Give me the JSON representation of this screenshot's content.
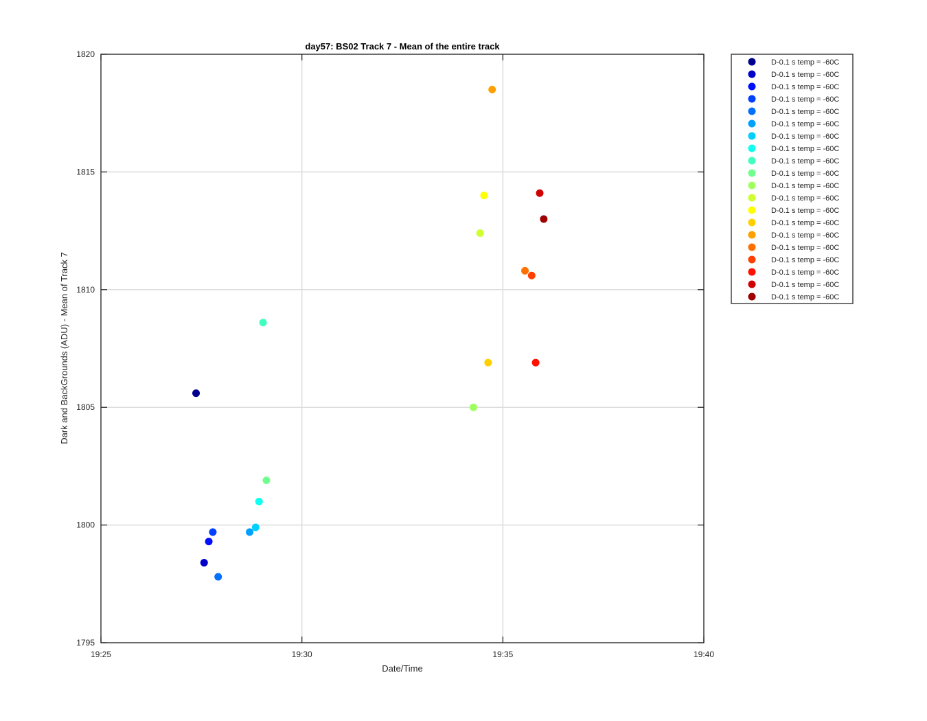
{
  "chart_data": {
    "type": "scatter",
    "title": "day57: BS02  Track 7 - Mean of the entire track",
    "xlabel": "Date/Time",
    "ylabel": "Dark and BackGrounds (ADU) - Mean of Track 7",
    "xlim": [
      "19:25",
      "19:40"
    ],
    "ylim": [
      1795,
      1820
    ],
    "xticks": [
      "19:25",
      "19:30",
      "19:35",
      "19:40"
    ],
    "yticks": [
      1795,
      1800,
      1805,
      1810,
      1815,
      1820
    ],
    "grid": true,
    "legend_position": "outside-right",
    "series": [
      {
        "name": "D-0.1 s temp = -60C",
        "color": "#00008f",
        "points": [
          {
            "x": "19:27:22",
            "y": 1805.6
          }
        ]
      },
      {
        "name": "D-0.1 s temp = -60C",
        "color": "#0000c8",
        "points": [
          {
            "x": "19:27:34",
            "y": 1798.4
          }
        ]
      },
      {
        "name": "D-0.1 s temp = -60C",
        "color": "#0010ff",
        "points": [
          {
            "x": "19:27:41",
            "y": 1799.3
          }
        ]
      },
      {
        "name": "D-0.1 s temp = -60C",
        "color": "#0040ff",
        "points": [
          {
            "x": "19:27:47",
            "y": 1799.7
          }
        ]
      },
      {
        "name": "D-0.1 s temp = -60C",
        "color": "#0070ff",
        "points": [
          {
            "x": "19:27:55",
            "y": 1797.8
          }
        ]
      },
      {
        "name": "D-0.1 s temp = -60C",
        "color": "#00a0ff",
        "points": [
          {
            "x": "19:28:42",
            "y": 1799.7
          }
        ]
      },
      {
        "name": "D-0.1 s temp = -60C",
        "color": "#00cfff",
        "points": [
          {
            "x": "19:28:51",
            "y": 1799.9
          }
        ]
      },
      {
        "name": "D-0.1 s temp = -60C",
        "color": "#10ffef",
        "points": [
          {
            "x": "19:28:56",
            "y": 1801.0
          }
        ]
      },
      {
        "name": "D-0.1 s temp = -60C",
        "color": "#40ffbf",
        "points": [
          {
            "x": "19:29:02",
            "y": 1808.6
          }
        ]
      },
      {
        "name": "D-0.1 s temp = -60C",
        "color": "#70ff8f",
        "points": [
          {
            "x": "19:29:07",
            "y": 1801.9
          }
        ]
      },
      {
        "name": "D-0.1 s temp = -60C",
        "color": "#9fff60",
        "points": [
          {
            "x": "19:34:16",
            "y": 1805.0
          }
        ]
      },
      {
        "name": "D-0.1 s temp = -60C",
        "color": "#cfff30",
        "points": [
          {
            "x": "19:34:26",
            "y": 1812.4
          }
        ]
      },
      {
        "name": "D-0.1 s temp = -60C",
        "color": "#ffff00",
        "points": [
          {
            "x": "19:34:32",
            "y": 1814.0
          }
        ]
      },
      {
        "name": "D-0.1 s temp = -60C",
        "color": "#ffcf00",
        "points": [
          {
            "x": "19:34:38",
            "y": 1806.9
          }
        ]
      },
      {
        "name": "D-0.1 s temp = -60C",
        "color": "#ff9f00",
        "points": [
          {
            "x": "19:34:44",
            "y": 1818.5
          }
        ]
      },
      {
        "name": "D-0.1 s temp = -60C",
        "color": "#ff7000",
        "points": [
          {
            "x": "19:35:33",
            "y": 1810.8
          }
        ]
      },
      {
        "name": "D-0.1 s temp = -60C",
        "color": "#ff4000",
        "points": [
          {
            "x": "19:35:43",
            "y": 1810.6
          }
        ]
      },
      {
        "name": "D-0.1 s temp = -60C",
        "color": "#ff1000",
        "points": [
          {
            "x": "19:35:49",
            "y": 1806.9
          }
        ]
      },
      {
        "name": "D-0.1 s temp = -60C",
        "color": "#cf0000",
        "points": [
          {
            "x": "19:35:55",
            "y": 1814.1
          }
        ]
      },
      {
        "name": "D-0.1 s temp = -60C",
        "color": "#9f0000",
        "points": [
          {
            "x": "19:36:01",
            "y": 1813.0
          }
        ]
      }
    ]
  }
}
